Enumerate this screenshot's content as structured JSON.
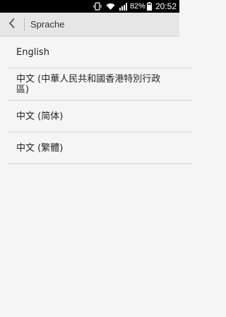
{
  "status_bar": {
    "battery_percent": "82%",
    "time": "20:52",
    "icons": [
      "nfc-vibrate-icon",
      "wifi-icon",
      "signal-icon",
      "battery-icon"
    ]
  },
  "action_bar": {
    "title": "Sprache",
    "back_icon": "chevron-left-icon"
  },
  "languages": [
    {
      "label": "English"
    },
    {
      "label": "中文 (中華人民共和國香港特別行政區)"
    },
    {
      "label": "中文 (简体)"
    },
    {
      "label": "中文 (繁體)"
    }
  ],
  "colors": {
    "status_bar": "#000000",
    "action_bar": "#e6e6e6",
    "background": "#f5f5f5",
    "divider": "#d6d6d6"
  }
}
